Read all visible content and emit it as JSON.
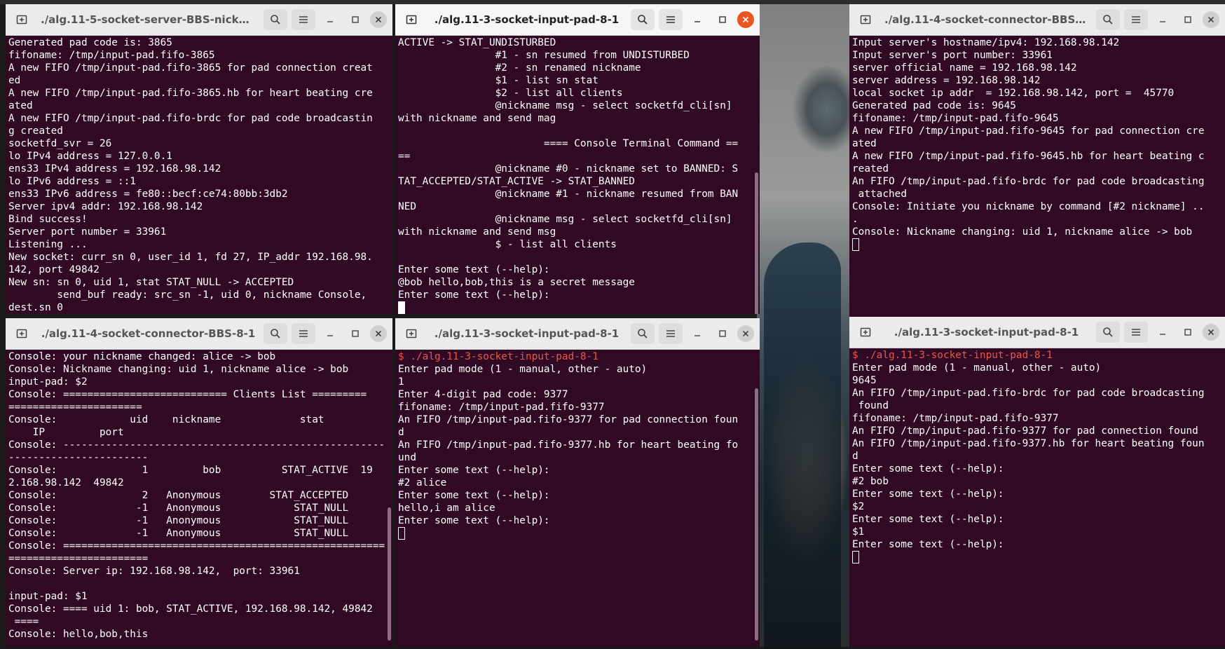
{
  "windows": [
    {
      "id": "w1",
      "title": "./alg.11-5-socket-server-BBS-nickn...",
      "lines": [
        {
          "text": "Generated pad code is: 3865"
        },
        {
          "text": "fifoname: /tmp/input-pad.fifo-3865"
        },
        {
          "text": "A new FIFO /tmp/input-pad.fifo-3865 for pad connection creat"
        },
        {
          "text": "ed"
        },
        {
          "text": "A new FIFO /tmp/input-pad.fifo-3865.hb for heart beating cre"
        },
        {
          "text": "ated"
        },
        {
          "text": "A new FIFO /tmp/input-pad.fifo-brdc for pad code broadcastin"
        },
        {
          "text": "g created"
        },
        {
          "text": "socketfd_svr = 26"
        },
        {
          "text": "lo IPv4 address = 127.0.0.1"
        },
        {
          "text": "ens33 IPv4 address = 192.168.98.142"
        },
        {
          "text": "lo IPv6 address = ::1"
        },
        {
          "text": "ens33 IPv6 address = fe80::becf:ce74:80bb:3db2"
        },
        {
          "text": "Server ipv4 addr: 192.168.98.142"
        },
        {
          "text": "Bind success!"
        },
        {
          "text": "Server port number = 33961"
        },
        {
          "text": "Listening ..."
        },
        {
          "text": "New socket: curr_sn 0, user_id 1, fd 27, IP_addr 192.168.98."
        },
        {
          "text": "142, port 49842"
        },
        {
          "text": "New sn: sn 0, uid 1, stat STAT_NULL -> ACCEPTED"
        },
        {
          "text": "        send_buf ready: src_sn -1, uid 0, nickname Console,"
        },
        {
          "text": "dest.sn 0"
        }
      ]
    },
    {
      "id": "w2",
      "title": "./alg.11-3-socket-input-pad-8-1",
      "lines": [
        {
          "text": "ACTIVE -> STAT_UNDISTURBED"
        },
        {
          "text": "                #1 - sn resumed from UNDISTURBED"
        },
        {
          "text": "                #2 - sn renamed nickname"
        },
        {
          "text": "                $1 - list sn stat"
        },
        {
          "text": "                $2 - list all clients"
        },
        {
          "text": "                @nickname msg - select socketfd_cli[sn]"
        },
        {
          "text": "with nickname and send mag"
        },
        {
          "text": ""
        },
        {
          "text": "                        ==== Console Terminal Command =="
        },
        {
          "text": "=="
        },
        {
          "text": "                @nickname #0 - nickname set to BANNED: S"
        },
        {
          "text": "TAT_ACCEPTED/STAT_ACTIVE -> STAT_BANNED"
        },
        {
          "text": "                @nickname #1 - nickname resumed from BAN"
        },
        {
          "text": "NED"
        },
        {
          "text": "                @nickname msg - select socketfd_cli[sn]"
        },
        {
          "text": "with nickname and send msg"
        },
        {
          "text": "                $ - list all clients"
        },
        {
          "text": ""
        },
        {
          "text": "Enter some text (--help):"
        },
        {
          "text": "@bob hello,bob,this is a secret message"
        },
        {
          "text": "Enter some text (--help):"
        },
        {
          "text": "",
          "cursor": "solid"
        }
      ]
    },
    {
      "id": "w3",
      "title": "./alg.11-4-socket-connector-BBS-...",
      "lines": [
        {
          "text": "Input server's hostname/ipv4: 192.168.98.142"
        },
        {
          "text": "Input server's port number: 33961"
        },
        {
          "text": "server official name = 192.168.98.142"
        },
        {
          "text": "server address = 192.168.98.142"
        },
        {
          "text": "local socket ip addr  = 192.168.98.142, port =  45770"
        },
        {
          "text": "Generated pad code is: 9645"
        },
        {
          "text": "fifoname: /tmp/input-pad.fifo-9645"
        },
        {
          "text": "A new FIFO /tmp/input-pad.fifo-9645 for pad connection cre"
        },
        {
          "text": "ated"
        },
        {
          "text": "A new FIFO /tmp/input-pad.fifo-9645.hb for heart beating c"
        },
        {
          "text": "reated"
        },
        {
          "text": "An FIFO /tmp/input-pad.fifo-brdc for pad code broadcasting"
        },
        {
          "text": " attached"
        },
        {
          "text": "Console: Initiate you nickname by command [#2 nickname] .."
        },
        {
          "text": "."
        },
        {
          "text": "Console: Nickname changing: uid 1, nickname alice -> bob"
        },
        {
          "text": "",
          "cursor": "hollow"
        }
      ]
    },
    {
      "id": "w4",
      "title": "./alg.11-4-socket-connector-BBS-8-1",
      "lines": [
        {
          "text": "Console: your nickname changed: alice -> bob"
        },
        {
          "text": "Console: Nickname changing: uid 1, nickname alice -> bob"
        },
        {
          "text": "input-pad: $2"
        },
        {
          "text": "Console: =========================== Clients List ========="
        },
        {
          "text": "======================"
        },
        {
          "text": "Console:            uid    nickname             stat"
        },
        {
          "text": "    IP         port"
        },
        {
          "text": "Console: -----------------------------------------------------"
        },
        {
          "text": "-----------------------"
        },
        {
          "text": "Console:              1         bob          STAT_ACTIVE  19"
        },
        {
          "text": "2.168.98.142  49842"
        },
        {
          "text": "Console:              2   Anonymous        STAT_ACCEPTED"
        },
        {
          "text": "Console:             -1   Anonymous            STAT_NULL"
        },
        {
          "text": "Console:             -1   Anonymous            STAT_NULL"
        },
        {
          "text": "Console:             -1   Anonymous            STAT_NULL"
        },
        {
          "text": "Console: ====================================================="
        },
        {
          "text": "======================="
        },
        {
          "text": "Console: Server ip: 192.168.98.142,  port: 33961"
        },
        {
          "text": ""
        },
        {
          "text": "input-pad: $1"
        },
        {
          "text": "Console: ==== uid 1: bob, STAT_ACTIVE, 192.168.98.142, 49842"
        },
        {
          "text": " ===="
        },
        {
          "text": "Console: hello,bob,this"
        }
      ]
    },
    {
      "id": "w5",
      "title": "./alg.11-3-socket-input-pad-8-1",
      "lines": [
        {
          "text": "$ ./alg.11-3-socket-input-pad-8-1",
          "prompt": true
        },
        {
          "text": "Enter pad mode (1 - manual, other - auto)"
        },
        {
          "text": "1"
        },
        {
          "text": "Enter 4-digit pad code: 9377"
        },
        {
          "text": "fifoname: /tmp/input-pad.fifo-9377"
        },
        {
          "text": "An FIFO /tmp/input-pad.fifo-9377 for pad connection foun"
        },
        {
          "text": "d"
        },
        {
          "text": "An FIFO /tmp/input-pad.fifo-9377.hb for heart beating fo"
        },
        {
          "text": "und"
        },
        {
          "text": "Enter some text (--help):"
        },
        {
          "text": "#2 alice"
        },
        {
          "text": "Enter some text (--help):"
        },
        {
          "text": "hello,i am alice"
        },
        {
          "text": "Enter some text (--help):"
        },
        {
          "text": "",
          "cursor": "hollow"
        }
      ]
    },
    {
      "id": "w6",
      "title": "./alg.11-3-socket-input-pad-8-1",
      "lines": [
        {
          "text": "$ ./alg.11-3-socket-input-pad-8-1",
          "prompt": true
        },
        {
          "text": "Enter pad mode (1 - manual, other - auto)"
        },
        {
          "text": "9645"
        },
        {
          "text": "An FIFO /tmp/input-pad.fifo-brdc for pad code broadcasting"
        },
        {
          "text": " found"
        },
        {
          "text": "fifoname: /tmp/input-pad.fifo-9377"
        },
        {
          "text": "An FIFO /tmp/input-pad.fifo-9377 for pad connection found"
        },
        {
          "text": "An FIFO /tmp/input-pad.fifo-9377.hb for heart beating foun"
        },
        {
          "text": "d"
        },
        {
          "text": "Enter some text (--help):"
        },
        {
          "text": "#2 bob"
        },
        {
          "text": "Enter some text (--help):"
        },
        {
          "text": "$2"
        },
        {
          "text": "Enter some text (--help):"
        },
        {
          "text": "$1"
        },
        {
          "text": "Enter some text (--help):"
        },
        {
          "text": "",
          "cursor": "hollow"
        }
      ]
    }
  ],
  "icons": {
    "new_tab": "new-tab-icon",
    "search": "search-icon",
    "menu": "hamburger-menu-icon",
    "minimize": "minimize-icon",
    "maximize": "maximize-icon",
    "close": "close-icon"
  },
  "colors": {
    "terminal_bg": "#300a24",
    "terminal_fg": "#ffffff",
    "prompt": "#e9564b",
    "close_active": "#e95420"
  }
}
